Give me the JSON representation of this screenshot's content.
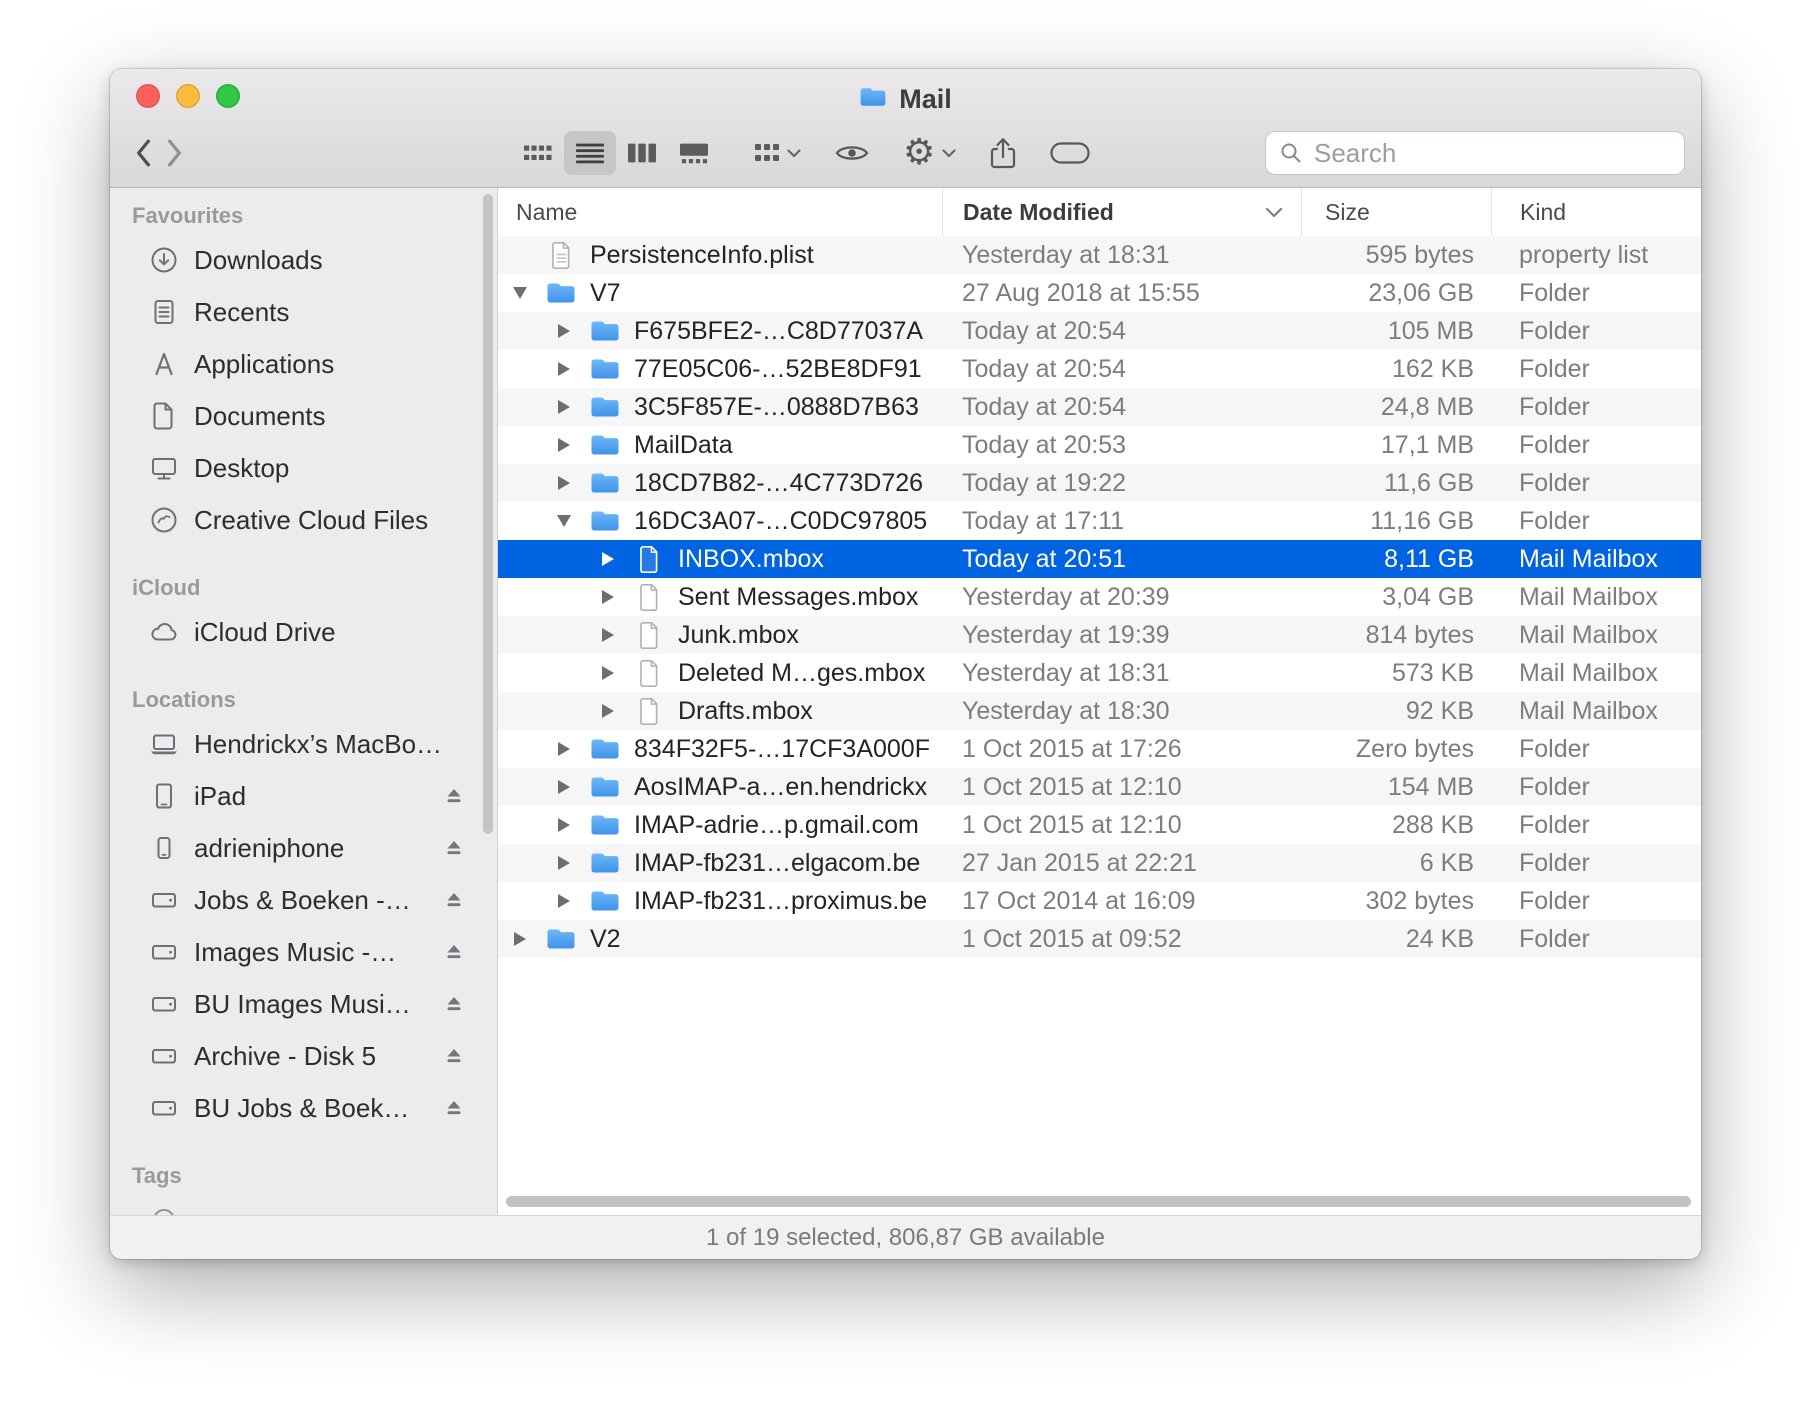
{
  "window": {
    "title": "Mail",
    "status_text": "1 of 19 selected, 806,87 GB available"
  },
  "toolbar": {
    "search_placeholder": "Search",
    "view_modes": [
      "icon",
      "list",
      "column",
      "gallery"
    ],
    "selected_view": "list",
    "buttons": [
      "back",
      "forward",
      "view-switcher",
      "group",
      "quick-look",
      "action",
      "share",
      "tag",
      "search"
    ]
  },
  "sidebar": {
    "sections": [
      {
        "label": "Favourites",
        "items": [
          {
            "label": "Downloads",
            "icon": "downloads-icon"
          },
          {
            "label": "Recents",
            "icon": "recents-icon"
          },
          {
            "label": "Applications",
            "icon": "applications-icon"
          },
          {
            "label": "Documents",
            "icon": "documents-icon"
          },
          {
            "label": "Desktop",
            "icon": "desktop-icon"
          },
          {
            "label": "Creative Cloud Files",
            "icon": "creative-cloud-icon"
          }
        ]
      },
      {
        "label": "iCloud",
        "items": [
          {
            "label": "iCloud Drive",
            "icon": "icloud-drive-icon"
          }
        ]
      },
      {
        "label": "Locations",
        "items": [
          {
            "label": "Hendrickx’s MacBo…",
            "icon": "macbook-icon"
          },
          {
            "label": "iPad",
            "icon": "ipad-icon",
            "eject": true
          },
          {
            "label": "adrieniphone",
            "icon": "iphone-icon",
            "eject": true
          },
          {
            "label": "Jobs & Boeken -…",
            "icon": "disk-icon",
            "eject": true
          },
          {
            "label": "Images Music -…",
            "icon": "disk-icon",
            "eject": true
          },
          {
            "label": "BU Images Musi…",
            "icon": "disk-icon",
            "eject": true
          },
          {
            "label": "Archive - Disk 5",
            "icon": "disk-icon",
            "eject": true
          },
          {
            "label": "BU Jobs & Boek…",
            "icon": "disk-icon",
            "eject": true
          }
        ]
      },
      {
        "label": "Tags",
        "items": [
          {
            "label": "",
            "icon": "tag-circle",
            "partial": true
          }
        ]
      }
    ]
  },
  "file_list": {
    "columns": [
      "Name",
      "Date Modified",
      "Size",
      "Kind"
    ],
    "sorted_column": "Date Modified",
    "sort_indicator": "down",
    "rows": [
      {
        "indent": 0,
        "disclosure": "none",
        "icon": "file-lines",
        "name": "PersistenceInfo.plist",
        "date": "Yesterday at 18:31",
        "size": "595 bytes",
        "kind": "property list"
      },
      {
        "indent": 0,
        "disclosure": "open",
        "icon": "folder",
        "name": "V7",
        "date": "27 Aug 2018 at 15:55",
        "size": "23,06 GB",
        "kind": "Folder"
      },
      {
        "indent": 1,
        "disclosure": "closed",
        "icon": "folder",
        "name": "F675BFE2-…C8D77037A",
        "date": "Today at 20:54",
        "size": "105 MB",
        "kind": "Folder"
      },
      {
        "indent": 1,
        "disclosure": "closed",
        "icon": "folder",
        "name": "77E05C06-…52BE8DF91",
        "date": "Today at 20:54",
        "size": "162 KB",
        "kind": "Folder"
      },
      {
        "indent": 1,
        "disclosure": "closed",
        "icon": "folder",
        "name": "3C5F857E-…0888D7B63",
        "date": "Today at 20:54",
        "size": "24,8 MB",
        "kind": "Folder"
      },
      {
        "indent": 1,
        "disclosure": "closed",
        "icon": "folder",
        "name": "MailData",
        "date": "Today at 20:53",
        "size": "17,1 MB",
        "kind": "Folder"
      },
      {
        "indent": 1,
        "disclosure": "closed",
        "icon": "folder",
        "name": "18CD7B82-…4C773D726",
        "date": "Today at 19:22",
        "size": "11,6 GB",
        "kind": "Folder"
      },
      {
        "indent": 1,
        "disclosure": "open",
        "icon": "folder",
        "name": "16DC3A07-…C0DC97805",
        "date": "Today at 17:11",
        "size": "11,16 GB",
        "kind": "Folder"
      },
      {
        "indent": 2,
        "disclosure": "closed",
        "icon": "file",
        "name": "INBOX.mbox",
        "date": "Today at 20:51",
        "size": "8,11 GB",
        "kind": "Mail Mailbox",
        "selected": true
      },
      {
        "indent": 2,
        "disclosure": "closed",
        "icon": "file",
        "name": "Sent Messages.mbox",
        "date": "Yesterday at 20:39",
        "size": "3,04 GB",
        "kind": "Mail Mailbox"
      },
      {
        "indent": 2,
        "disclosure": "closed",
        "icon": "file",
        "name": "Junk.mbox",
        "date": "Yesterday at 19:39",
        "size": "814 bytes",
        "kind": "Mail Mailbox"
      },
      {
        "indent": 2,
        "disclosure": "closed",
        "icon": "file",
        "name": "Deleted M…ges.mbox",
        "date": "Yesterday at 18:31",
        "size": "573 KB",
        "kind": "Mail Mailbox"
      },
      {
        "indent": 2,
        "disclosure": "closed",
        "icon": "file",
        "name": "Drafts.mbox",
        "date": "Yesterday at 18:30",
        "size": "92 KB",
        "kind": "Mail Mailbox"
      },
      {
        "indent": 1,
        "disclosure": "closed",
        "icon": "folder",
        "name": "834F32F5-…17CF3A000F",
        "date": "1 Oct 2015 at 17:26",
        "size": "Zero bytes",
        "kind": "Folder"
      },
      {
        "indent": 1,
        "disclosure": "closed",
        "icon": "folder",
        "name": "AosIMAP-a…en.hendrickx",
        "date": "1 Oct 2015 at 12:10",
        "size": "154 MB",
        "kind": "Folder"
      },
      {
        "indent": 1,
        "disclosure": "closed",
        "icon": "folder",
        "name": "IMAP-adrie…p.gmail.com",
        "date": "1 Oct 2015 at 12:10",
        "size": "288 KB",
        "kind": "Folder"
      },
      {
        "indent": 1,
        "disclosure": "closed",
        "icon": "folder",
        "name": "IMAP-fb231…elgacom.be",
        "date": "27 Jan 2015 at 22:21",
        "size": "6 KB",
        "kind": "Folder"
      },
      {
        "indent": 1,
        "disclosure": "closed",
        "icon": "folder",
        "name": "IMAP-fb231…proximus.be",
        "date": "17 Oct 2014 at 16:09",
        "size": "302 bytes",
        "kind": "Folder"
      },
      {
        "indent": 0,
        "disclosure": "closed",
        "icon": "folder",
        "name": "V2",
        "date": "1 Oct 2015 at 09:52",
        "size": "24 KB",
        "kind": "Folder"
      }
    ]
  }
}
